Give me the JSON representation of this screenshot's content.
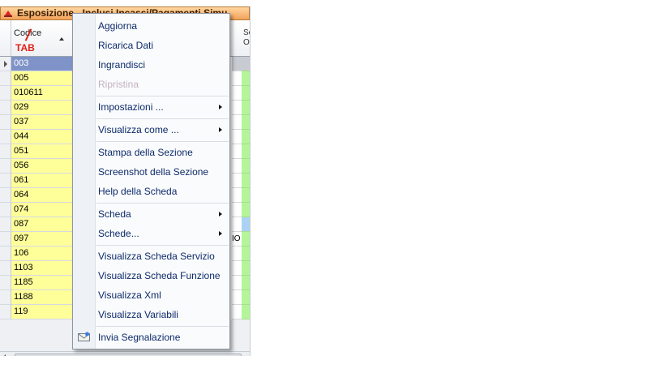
{
  "window": {
    "title": "Esposizione - Inclusi Incassi/Pagamenti Simu",
    "columns": {
      "codice": "Codice",
      "right": "Se O"
    },
    "annotation": "TAB"
  },
  "rows": [
    {
      "code": "003",
      "mid": ""
    },
    {
      "code": "005",
      "mid": ""
    },
    {
      "code": "010611",
      "mid": ""
    },
    {
      "code": "029",
      "mid": ""
    },
    {
      "code": "037",
      "mid": ""
    },
    {
      "code": "044",
      "mid": ""
    },
    {
      "code": "051",
      "mid": ""
    },
    {
      "code": "056",
      "mid": ""
    },
    {
      "code": "061",
      "mid": ""
    },
    {
      "code": "064",
      "mid": ""
    },
    {
      "code": "074",
      "mid": ""
    },
    {
      "code": "087",
      "mid": ""
    },
    {
      "code": "097",
      "mid": "IO"
    },
    {
      "code": "106",
      "mid": ""
    },
    {
      "code": "1103",
      "mid": ""
    },
    {
      "code": "1185",
      "mid": ""
    },
    {
      "code": "1188",
      "mid": ""
    },
    {
      "code": "119",
      "mid": ""
    }
  ],
  "menu": {
    "items": [
      {
        "label": "Aggiorna"
      },
      {
        "label": "Ricarica Dati"
      },
      {
        "label": "Ingrandisci"
      },
      {
        "label": "Ripristina",
        "disabled": true
      },
      {
        "label": "Impostazioni ...",
        "submenu": true
      },
      {
        "label": "Visualizza come ...",
        "submenu": true
      },
      {
        "label": "Stampa della Sezione"
      },
      {
        "label": "Screenshot della Sezione"
      },
      {
        "label": "Help della Scheda"
      },
      {
        "label": "Scheda",
        "submenu": true
      },
      {
        "label": "Schede...",
        "submenu": true
      },
      {
        "label": "Visualizza Scheda Servizio"
      },
      {
        "label": "Visualizza Scheda Funzione"
      },
      {
        "label": "Visualizza Xml"
      },
      {
        "label": "Visualizza Variabili"
      },
      {
        "label": "Invia Segnalazione",
        "icon": "mail-icon"
      }
    ]
  },
  "colors": {
    "code_cell": "#ffff9a",
    "selected_row": "#7f93c8",
    "status_green": "#b5f59a",
    "menu_text": "#0c2a6b"
  }
}
